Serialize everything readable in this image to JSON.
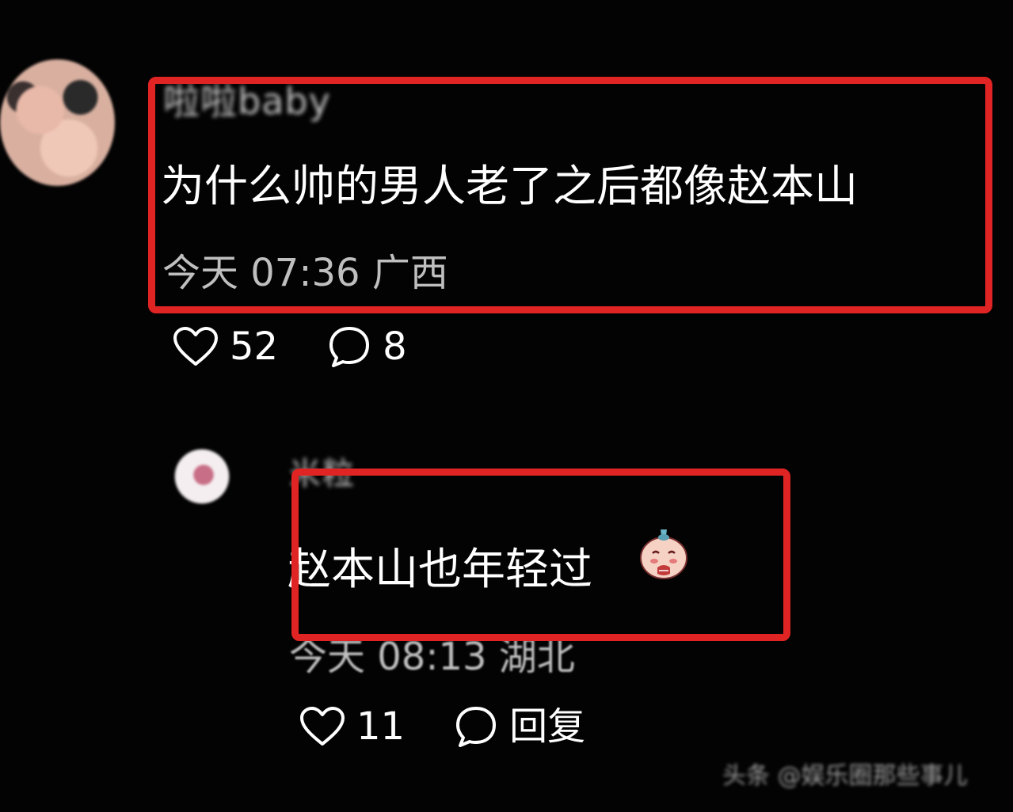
{
  "comments": [
    {
      "avatar_icon": "avatar-icon",
      "username": "啦啦baby",
      "text": "为什么帅的男人老了之后都像赵本山",
      "meta": "今天 07:36 广西",
      "likes": "52",
      "replies": "8"
    },
    {
      "avatar_icon": "avatar-icon",
      "username": "米粒",
      "text": "赵本山也年轻过",
      "emoji": "pleading-face-emoji",
      "meta": "今天 08:13 湖北",
      "likes": "11",
      "reply_label": "回复"
    }
  ],
  "watermark": "头条 @娱乐圈那些事儿",
  "colors": {
    "background": "#030303",
    "highlight": "#e02424",
    "text": "#ffffff",
    "meta": "#bfbfbf"
  }
}
